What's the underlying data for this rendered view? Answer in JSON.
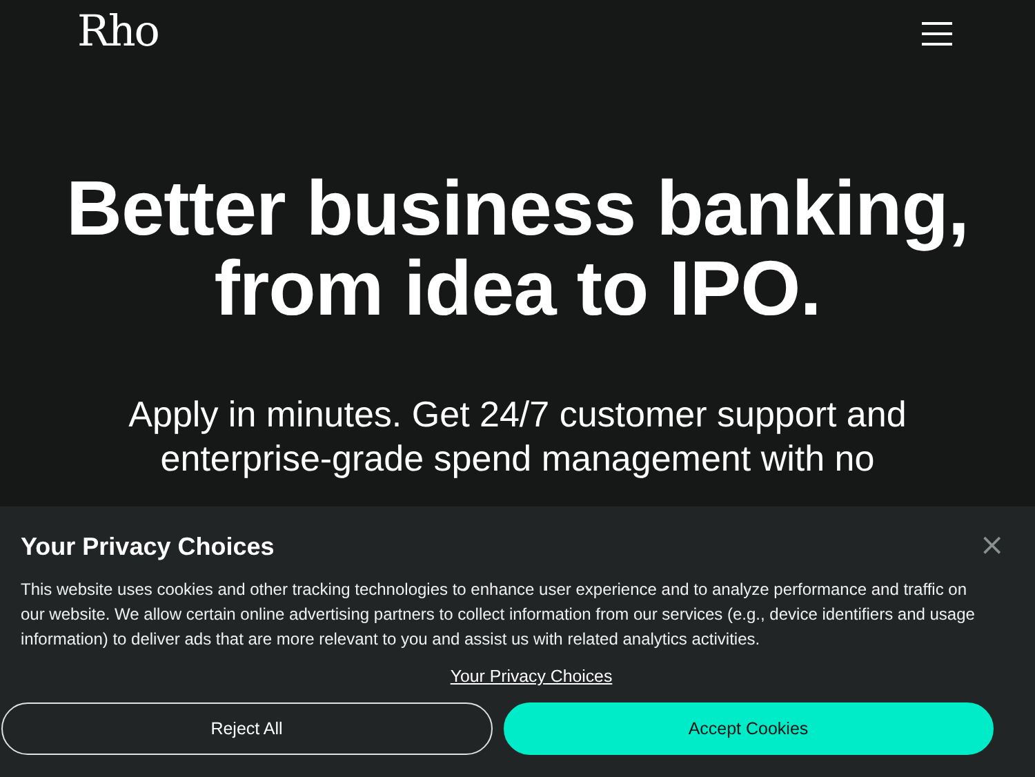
{
  "header": {
    "logo": "Rho"
  },
  "hero": {
    "headline": "Better business banking, from idea to IPO.",
    "subtitle": "Apply in minutes. Get 24/7 customer support and enterprise-grade spend management with no"
  },
  "privacy_banner": {
    "title": "Your Privacy Choices",
    "close": "×",
    "body": "This website uses cookies and other tracking technologies to enhance user experience and to analyze performance and traffic on our website. We allow certain online advertising partners to collect information from our services (e.g., device identifiers and usage information) to deliver ads that are more relevant to you and assist us with related analytics activities.",
    "link": "Your Privacy Choices",
    "buttons": [
      {
        "label": "Reject All",
        "kind": "outline"
      },
      {
        "label": "Accept Cookies",
        "kind": "primary"
      }
    ]
  }
}
